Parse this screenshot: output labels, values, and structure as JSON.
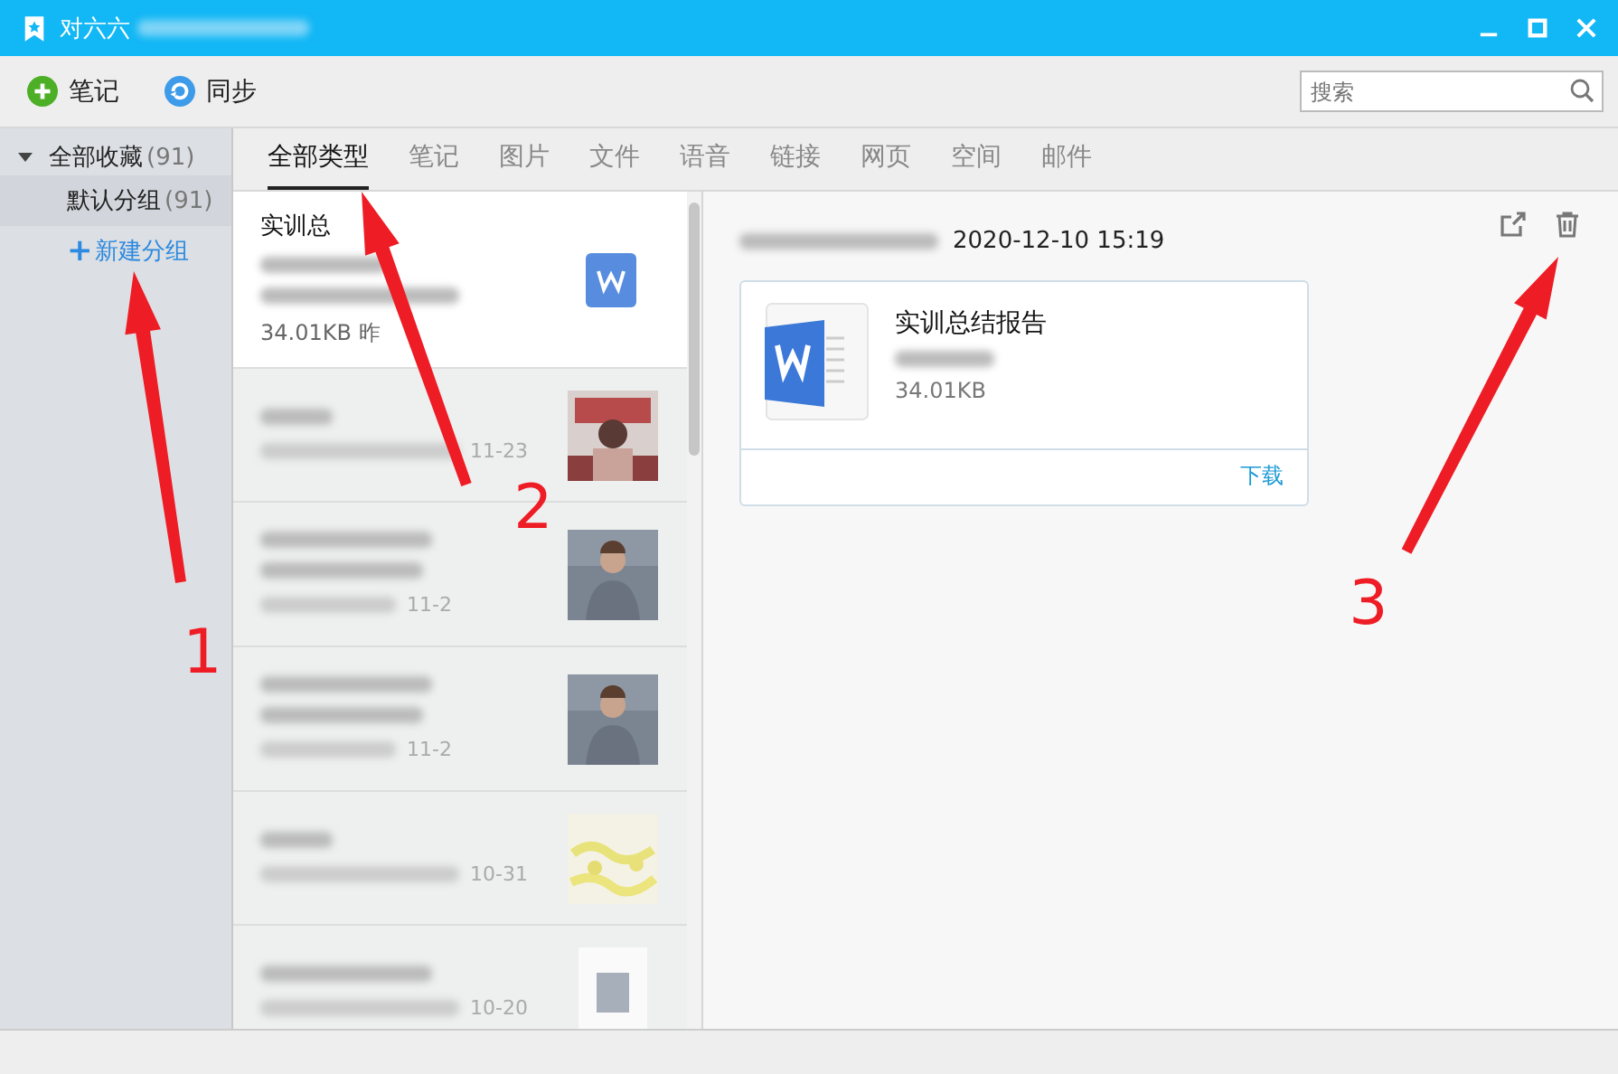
{
  "window": {
    "title": "对六六"
  },
  "toolbar": [
    {
      "label": "笔记",
      "kind": "add"
    },
    {
      "label": "同步",
      "kind": "sync"
    }
  ],
  "search": {
    "placeholder": "搜索"
  },
  "sidebar": {
    "root": {
      "label": "全部收藏",
      "count": "(91)",
      "expanded": true
    },
    "groups": [
      {
        "label": "默认分组",
        "count": "(91)",
        "selected": true
      }
    ],
    "new_group": {
      "icon": "+",
      "label": "新建分组"
    }
  },
  "tabs": [
    {
      "label": "全部类型",
      "selected": true
    },
    {
      "label": "笔记",
      "selected": false
    },
    {
      "label": "图片",
      "selected": false
    },
    {
      "label": "文件",
      "selected": false
    },
    {
      "label": "语音",
      "selected": false
    },
    {
      "label": "链接",
      "selected": false
    },
    {
      "label": "网页",
      "selected": false
    },
    {
      "label": "空间",
      "selected": false
    },
    {
      "label": "邮件",
      "selected": false
    }
  ],
  "notes": [
    {
      "title": "实训总",
      "meta": "34.01KB 昨",
      "kind": "word",
      "selected": true
    },
    {
      "time": "11-23",
      "kind": "picture",
      "selected": false
    },
    {
      "time": "11-2",
      "kind": "picture",
      "selected": false
    },
    {
      "time": "11-2",
      "kind": "picture",
      "selected": false
    },
    {
      "time": "10-31",
      "kind": "picture",
      "selected": false
    },
    {
      "time": "10-20",
      "kind": "doc",
      "selected": false
    }
  ],
  "detail": {
    "date": "2020-12-10 15:19",
    "file": {
      "name": "实训总结报告",
      "size": "34.01KB",
      "action": "下载"
    }
  },
  "annotations": [
    {
      "label": "1"
    },
    {
      "label": "2"
    },
    {
      "label": "3"
    }
  ]
}
